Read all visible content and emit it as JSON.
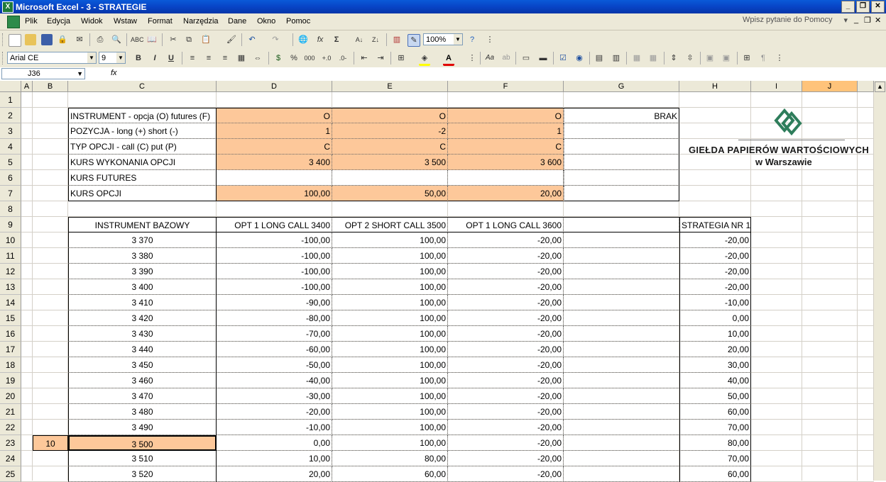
{
  "window": {
    "title": "Microsoft Excel - 3 - STRATEGIE",
    "app_icon": "X"
  },
  "menu": [
    "Plik",
    "Edycja",
    "Widok",
    "Wstaw",
    "Format",
    "Narzędzia",
    "Dane",
    "Okno",
    "Pomoc"
  ],
  "help_placeholder": "Wpisz pytanie do Pomocy",
  "toolbar": {
    "zoom": "100%",
    "font": "Arial CE",
    "size": "9",
    "bold": "B",
    "italic": "I",
    "underline": "U",
    "percent": "%",
    "thousands": "000"
  },
  "formula_bar": {
    "name_box": "J36",
    "fx": "fx",
    "value": ""
  },
  "columns": [
    "A",
    "B",
    "C",
    "D",
    "E",
    "F",
    "G",
    "H",
    "I",
    "J"
  ],
  "rows": [
    "1",
    "2",
    "3",
    "4",
    "5",
    "6",
    "7",
    "8",
    "9",
    "10",
    "11",
    "12",
    "13",
    "14",
    "15",
    "16",
    "17",
    "18",
    "19",
    "20",
    "21",
    "22",
    "23",
    "24",
    "25"
  ],
  "params": [
    {
      "label": "INSTRUMENT - opcja (O) futures (F)",
      "d": "O",
      "e": "O",
      "f": "O",
      "g": "BRAK"
    },
    {
      "label": "POZYCJA - long (+) short (-)",
      "d": "1",
      "e": "-2",
      "f": "1",
      "g": ""
    },
    {
      "label": "TYP OPCJI - call (C) put (P)",
      "d": "C",
      "e": "C",
      "f": "C",
      "g": ""
    },
    {
      "label": "KURS WYKONANIA OPCJI",
      "d": "3 400",
      "e": "3 500",
      "f": "3 600",
      "g": ""
    },
    {
      "label": "KURS FUTURES",
      "d": "",
      "e": "",
      "f": "",
      "g": ""
    },
    {
      "label": "KURS OPCJI",
      "d": "100,00",
      "e": "50,00",
      "f": "20,00",
      "g": ""
    }
  ],
  "table_headers": {
    "c": "INSTRUMENT BAZOWY",
    "d": "OPT 1 LONG CALL 3400",
    "e": "OPT 2  SHORT CALL 3500",
    "f": "OPT 1 LONG CALL 3600",
    "g": "",
    "h": "STRATEGIA NR 1"
  },
  "table_rows": [
    {
      "b": "",
      "c": "3 370",
      "d": "-100,00",
      "e": "100,00",
      "f": "-20,00",
      "h": "-20,00"
    },
    {
      "b": "",
      "c": "3 380",
      "d": "-100,00",
      "e": "100,00",
      "f": "-20,00",
      "h": "-20,00"
    },
    {
      "b": "",
      "c": "3 390",
      "d": "-100,00",
      "e": "100,00",
      "f": "-20,00",
      "h": "-20,00"
    },
    {
      "b": "",
      "c": "3 400",
      "d": "-100,00",
      "e": "100,00",
      "f": "-20,00",
      "h": "-20,00"
    },
    {
      "b": "",
      "c": "3 410",
      "d": "-90,00",
      "e": "100,00",
      "f": "-20,00",
      "h": "-10,00"
    },
    {
      "b": "",
      "c": "3 420",
      "d": "-80,00",
      "e": "100,00",
      "f": "-20,00",
      "h": "0,00"
    },
    {
      "b": "",
      "c": "3 430",
      "d": "-70,00",
      "e": "100,00",
      "f": "-20,00",
      "h": "10,00"
    },
    {
      "b": "",
      "c": "3 440",
      "d": "-60,00",
      "e": "100,00",
      "f": "-20,00",
      "h": "20,00"
    },
    {
      "b": "",
      "c": "3 450",
      "d": "-50,00",
      "e": "100,00",
      "f": "-20,00",
      "h": "30,00"
    },
    {
      "b": "",
      "c": "3 460",
      "d": "-40,00",
      "e": "100,00",
      "f": "-20,00",
      "h": "40,00"
    },
    {
      "b": "",
      "c": "3 470",
      "d": "-30,00",
      "e": "100,00",
      "f": "-20,00",
      "h": "50,00"
    },
    {
      "b": "",
      "c": "3 480",
      "d": "-20,00",
      "e": "100,00",
      "f": "-20,00",
      "h": "60,00"
    },
    {
      "b": "",
      "c": "3 490",
      "d": "-10,00",
      "e": "100,00",
      "f": "-20,00",
      "h": "70,00"
    },
    {
      "b": "10",
      "c": "3 500",
      "d": "0,00",
      "e": "100,00",
      "f": "-20,00",
      "h": "80,00"
    },
    {
      "b": "",
      "c": "3 510",
      "d": "10,00",
      "e": "80,00",
      "f": "-20,00",
      "h": "70,00"
    },
    {
      "b": "",
      "c": "3 520",
      "d": "20,00",
      "e": "60,00",
      "f": "-20,00",
      "h": "60,00"
    }
  ],
  "logo": {
    "line1": "GIEŁDA PAPIERÓW WARTOŚCIOWYCH",
    "line2": "w Warszawie",
    "color": "#2e7d5b"
  },
  "colors": {
    "accent_orange": "#fdc89a",
    "title_blue": "#0a5ad8",
    "selected_header": "#ffc37a"
  }
}
